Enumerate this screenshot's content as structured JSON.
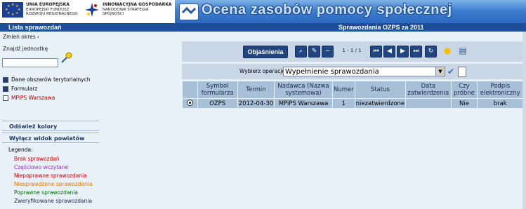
{
  "header": {
    "eu_line1": "UNIA EUROPEJSKA",
    "eu_line2": "EUROPEJSKI FUNDUSZ",
    "eu_line3": "ROZWOJU REGIONALNEGO",
    "ig_line1": "INNOWACYJNA GOSPODARKA",
    "ig_line2": "NARODOWA STRATEGIA",
    "ig_line3": "SPÓJNOŚCI",
    "app_title": "Ocena zasobów pomocy społecznej"
  },
  "bluebar": {
    "left": "Lista sprawozdań",
    "right": "Sprawozdania OZPS za 2011"
  },
  "sidebar": {
    "change_period": "Zmień okres",
    "change_period_arrow": "›",
    "find_unit": "Znajdź jednostkę",
    "find_value": "",
    "checks": [
      {
        "label": "Dane obszarów terytorialnych",
        "checked": true
      },
      {
        "label": "Formularz",
        "checked": true
      },
      {
        "label": "MPiPS Warszawa",
        "checked": false
      }
    ],
    "refresh_colors": "Odśwież kolory",
    "disable_powiat_view": "Wyłącz widok powiatów",
    "legend_label": "Legenda:",
    "legend": [
      {
        "label": "Brak sprawozdań",
        "color": "#d40000"
      },
      {
        "label": "Częściowo wczytane",
        "color": "#9a30c0"
      },
      {
        "label": "Niepoprawne sprawozdania",
        "color": "#c00000"
      },
      {
        "label": "Niesprawdzone sprawozdania",
        "color": "#e07800"
      },
      {
        "label": "Poprawne sprawozdania",
        "color": "#007000"
      },
      {
        "label": "Zweryfikowane sprawozdania",
        "color": "#1a2a4a"
      }
    ]
  },
  "toolbar": {
    "explanations": "Objaśnienia",
    "pager": "1 - 1 / 1"
  },
  "operation": {
    "label": "Wybierz operację:",
    "selected": "Wypełnienie sprawozdania"
  },
  "table": {
    "headers": [
      "Symbol formularza",
      "Termin",
      "Nadawca (Nazwa systemowa)",
      "Numer",
      "Status",
      "Data zatwierdzenia",
      "Czy próbne",
      "Podpis elektroniczny"
    ],
    "rows": [
      [
        "OZPS",
        "2012-04-30",
        "MPiPS Warszawa",
        "1",
        "niezatwierdzone",
        "",
        "Nie",
        "brak"
      ]
    ]
  }
}
